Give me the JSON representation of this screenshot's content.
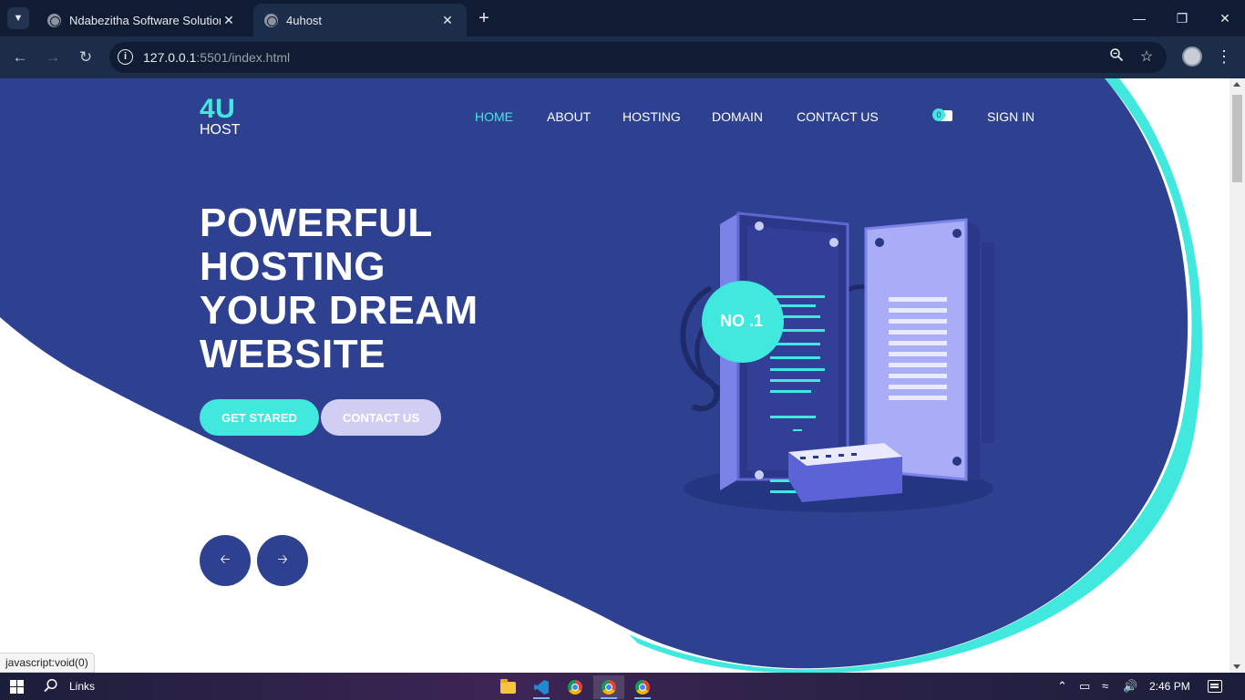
{
  "browser": {
    "tabs": [
      {
        "title": "Ndabezitha Software Solutions",
        "active": false
      },
      {
        "title": "4uhost",
        "active": true
      }
    ],
    "url_host": "127.0.0.1",
    "url_path": ":5501/index.html",
    "status_text": "javascript:void(0)"
  },
  "site": {
    "logo_top": "4U",
    "logo_bottom": "HOST",
    "nav": [
      "HOME",
      "ABOUT",
      "HOSTING",
      "DOMAIN",
      "CONTACT US"
    ],
    "cart_count": "0",
    "sign_in": "SIGN IN",
    "headline": [
      "POWERFUL",
      "HOSTING",
      "YOUR DREAM",
      "WEBSITE"
    ],
    "primary_button": "GET STARED",
    "secondary_button": "CONTACT US",
    "badge_text": "NO .1",
    "colors": {
      "hero_blue": "#2e4190",
      "accent_cyan": "#40e8dd",
      "lavender": "#d0cff3"
    }
  },
  "taskbar": {
    "search_label": "Links",
    "time": "2:46 PM"
  }
}
